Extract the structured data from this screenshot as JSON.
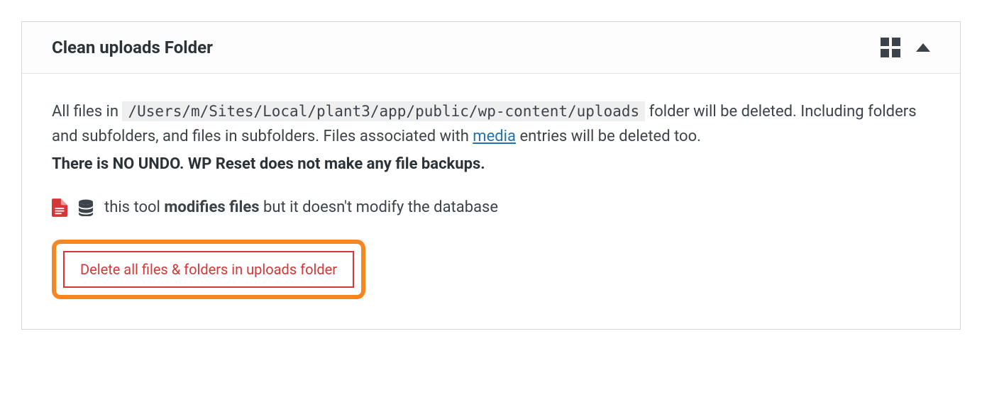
{
  "card": {
    "title": "Clean uploads Folder",
    "description": {
      "prefix": "All files in ",
      "path": "/Users/m/Sites/Local/plant3/app/public/wp-content/uploads",
      "mid1": " folder will be deleted. Including folders and subfolders, and files in subfolders. Files associated with ",
      "media_link": "media",
      "mid2": " entries will be deleted too."
    },
    "warning": "There is NO UNDO. WP Reset does not make any file backups.",
    "tool_info": {
      "prefix": "this tool ",
      "bold": "modifies files",
      "suffix": " but it doesn't modify the database"
    },
    "action_button": "Delete all files & folders in uploads folder"
  }
}
